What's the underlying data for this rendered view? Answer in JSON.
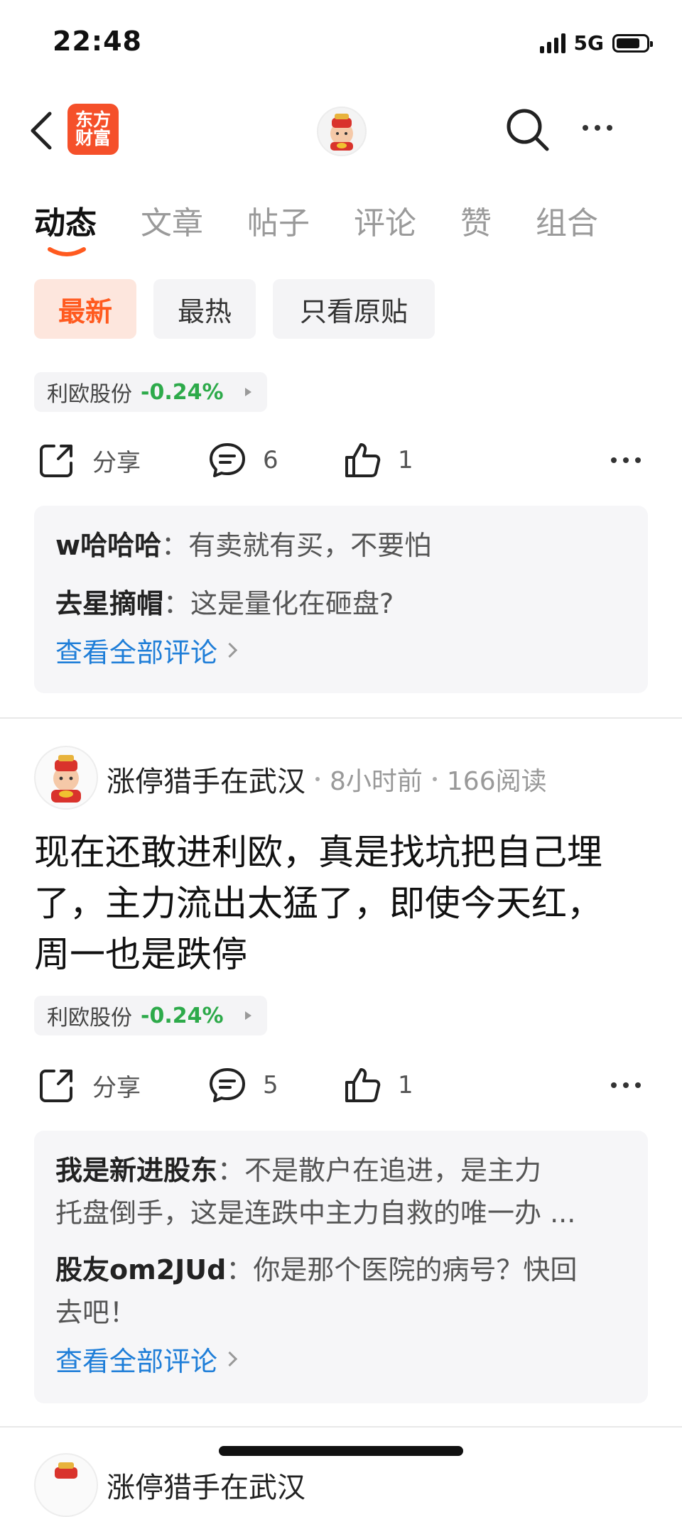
{
  "status": {
    "time": "22:48",
    "network": "5G"
  },
  "header": {
    "logo_line1": "东方",
    "logo_line2": "财富"
  },
  "tabs": [
    {
      "label": "动态",
      "active": true
    },
    {
      "label": "文章",
      "active": false
    },
    {
      "label": "帖子",
      "active": false
    },
    {
      "label": "评论",
      "active": false
    },
    {
      "label": "赞",
      "active": false
    },
    {
      "label": "组合",
      "active": false
    }
  ],
  "filters": [
    {
      "label": "最新",
      "active": true
    },
    {
      "label": "最热",
      "active": false
    },
    {
      "label": "只看原贴",
      "active": false
    }
  ],
  "accent_color": "#ff5a1f",
  "down_color": "#2daa4a",
  "link_color": "#1f7ed8",
  "posts": [
    {
      "stock_name": "利欧股份",
      "stock_change": "-0.24%",
      "share_label": "分享",
      "comment_count": "6",
      "like_count": "1",
      "comments": [
        {
          "author": "w哈哈哈",
          "text": "有卖就有买，不要怕"
        },
        {
          "author": "去星摘帽",
          "text": "这是量化在砸盘?"
        }
      ],
      "view_all": "查看全部评论"
    },
    {
      "author": "涨停猎手在武汉",
      "time": "8小时前",
      "reads": "166阅读",
      "body_line1": "现在还敢进利欧，真是找坑把自己埋",
      "body_line2": "了，主力流出太猛了，即使今天红，",
      "body_line3": "周一也是跌停",
      "stock_name": "利欧股份",
      "stock_change": "-0.24%",
      "share_label": "分享",
      "comment_count": "5",
      "like_count": "1",
      "comments": [
        {
          "author": "我是新进股东",
          "text_line1": "不是散户在追进，是主力",
          "text_line2": "托盘倒手，这是连跌中主力自救的唯一办 ..."
        },
        {
          "author": "股友om2JUd",
          "text_line1": "你是那个医院的病号？快回",
          "text_line2": "去吧！"
        }
      ],
      "view_all": "查看全部评论"
    },
    {
      "author": "涨停猎手在武汉"
    }
  ]
}
